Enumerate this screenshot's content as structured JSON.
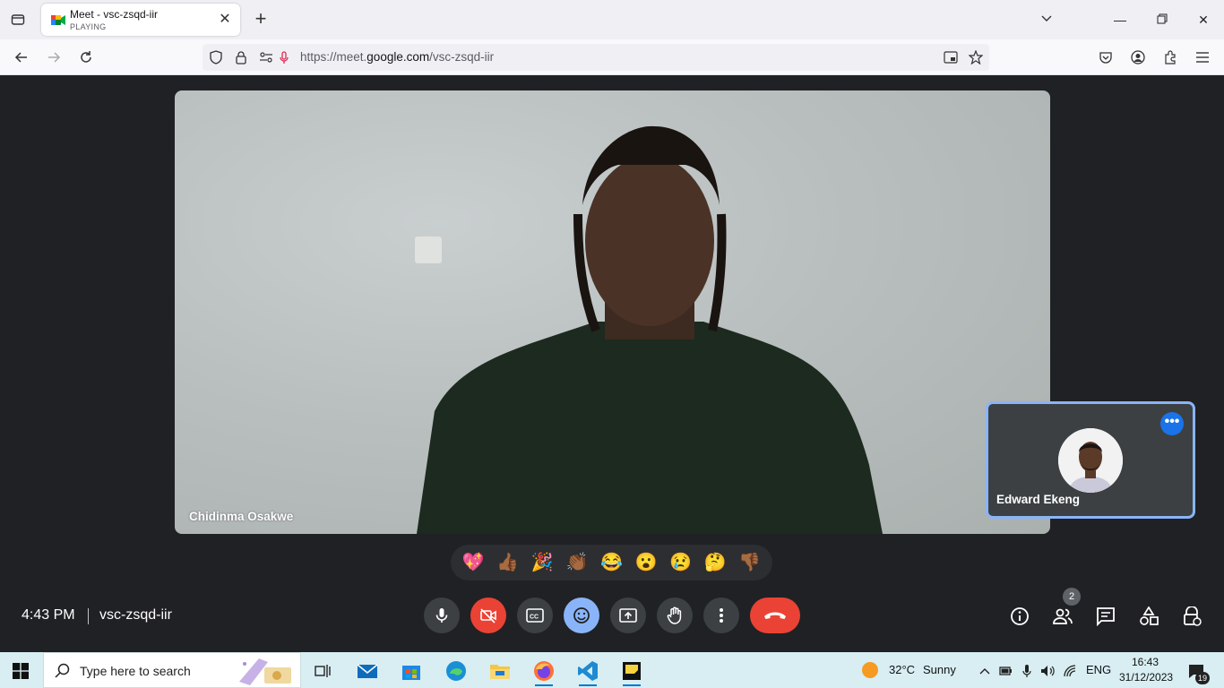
{
  "browser": {
    "tab": {
      "title": "Meet - vsc-zsqd-iir",
      "subtitle": "PLAYING"
    },
    "url": {
      "prefix": "https://meet.",
      "domain": "google.com",
      "path": "/vsc-zsqd-iir"
    }
  },
  "meet": {
    "main_participant": "Chidinma Osakwe",
    "self_participant": "Edward Ekeng",
    "reactions": [
      "💖",
      "👍🏾",
      "🎉",
      "👏🏾",
      "😂",
      "😮",
      "😢",
      "🤔",
      "👎🏾"
    ],
    "time": "4:43 PM",
    "meeting_code": "vsc-zsqd-iir",
    "participants_count": "2",
    "colors": {
      "end_call": "#ea4335",
      "active": "#8ab4f8",
      "button": "#3c4043"
    }
  },
  "taskbar": {
    "search_placeholder": "Type here to search",
    "weather": {
      "temp": "32°C",
      "condition": "Sunny"
    },
    "language": "ENG",
    "clock_time": "16:43",
    "clock_date": "31/12/2023",
    "notifications": "19"
  }
}
